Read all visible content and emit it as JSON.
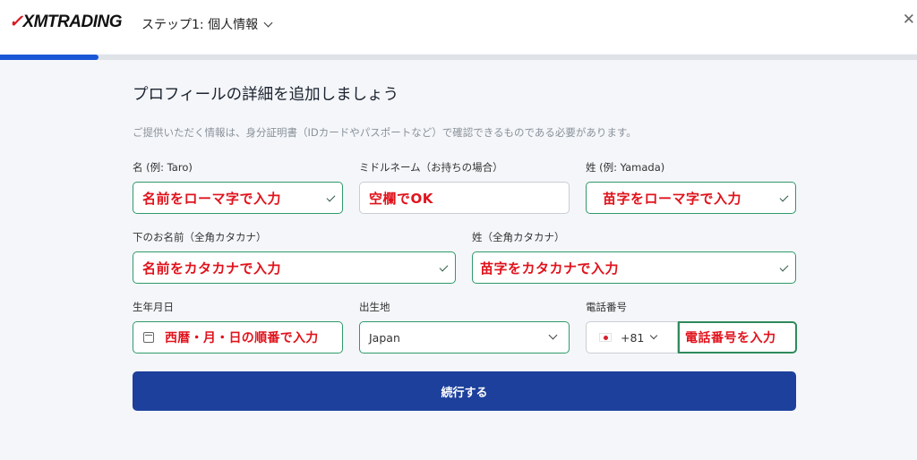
{
  "header": {
    "logo": "XMTRADING",
    "step": "ステップ1: 個人情報",
    "close_icon": "close-icon"
  },
  "progress": {
    "percent": 10.7
  },
  "form": {
    "title": "プロフィールの詳細を追加しましょう",
    "subtitle": "ご提供いただく情報は、身分証明書（IDカードやパスポートなど）で確認できるものである必要があります。",
    "first_name": {
      "label": "名 (例: Taro)",
      "value": "名前をローマ字で入力"
    },
    "middle_name": {
      "label": "ミドルネーム（お持ちの場合）",
      "value": "空欄でOK"
    },
    "last_name": {
      "label": "姓 (例: Yamada)",
      "value": "苗字をローマ字で入力"
    },
    "first_name_kana": {
      "label": "下のお名前（全角カタカナ）",
      "value": "名前をカタカナで入力"
    },
    "last_name_kana": {
      "label": "姓（全角カタカナ）",
      "value": "苗字をカタカナで入力"
    },
    "birthdate": {
      "label": "生年月日",
      "value": "西暦・月・日の順番で入力"
    },
    "birthplace": {
      "label": "出生地",
      "value": "Japan"
    },
    "phone": {
      "label": "電話番号",
      "country_code": "+81",
      "value": "電話番号を入力"
    },
    "submit_label": "続行する"
  },
  "colors": {
    "accent": "#1a57d6",
    "button": "#1c409b",
    "valid": "#2f9a6a",
    "annotation": "#e0131c"
  }
}
